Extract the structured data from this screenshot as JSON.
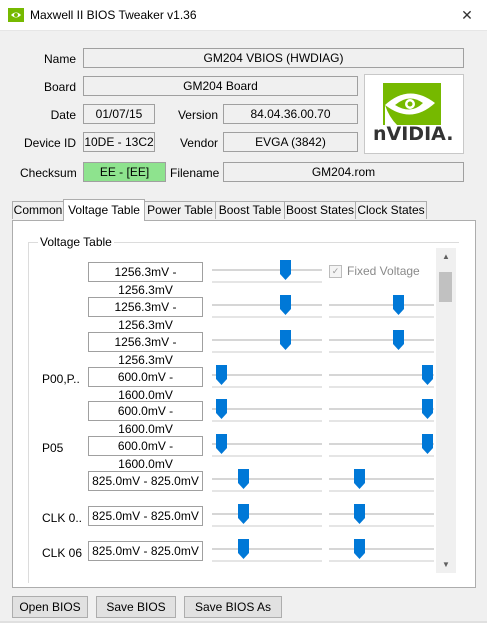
{
  "window": {
    "title": "Maxwell II BIOS Tweaker v1.36",
    "close_glyph": "✕"
  },
  "info": {
    "name_label": "Name",
    "name": "GM204 VBIOS (HWDIAG)",
    "board_label": "Board",
    "board": "GM204 Board",
    "date_label": "Date",
    "date": "01/07/15",
    "version_label": "Version",
    "version": "84.04.36.00.70",
    "device_label": "Device ID",
    "device_id": "10DE - 13C2",
    "vendor_label": "Vendor",
    "vendor": "EVGA (3842)",
    "checksum_label": "Checksum",
    "checksum": "EE - [EE]",
    "filename_label": "Filename",
    "filename": "GM204.rom"
  },
  "logo": {
    "text": "nVIDIA.",
    "icon": "nvidia-eye-icon",
    "color": "#76b900"
  },
  "tabs": [
    "Common",
    "Voltage Table",
    "Power Table",
    "Boost Table",
    "Boost States",
    "Clock States"
  ],
  "active_tab": "Voltage Table",
  "voltage_table": {
    "title": "Voltage Table",
    "fixed_voltage_label": "Fixed Voltage",
    "fixed_voltage_checked": true,
    "rows": [
      {
        "label": "",
        "value": "1256.3mV - 1256.3mV"
      },
      {
        "label": "",
        "value": "1256.3mV - 1256.3mV"
      },
      {
        "label": "",
        "value": "1256.3mV - 1256.3mV"
      },
      {
        "label": "P00,P..",
        "value": "600.0mV - 1600.0mV"
      },
      {
        "label": "",
        "value": "600.0mV - 1600.0mV"
      },
      {
        "label": "P05",
        "value": "600.0mV - 1600.0mV"
      },
      {
        "label": "",
        "value": "825.0mV - 825.0mV"
      },
      {
        "label": "CLK 0..",
        "value": "825.0mV - 825.0mV"
      },
      {
        "label": "CLK 06",
        "value": "825.0mV - 825.0mV"
      }
    ]
  },
  "buttons": {
    "open": "Open BIOS",
    "save": "Save BIOS",
    "save_as": "Save BIOS As"
  },
  "colors": {
    "accent": "#0078d7",
    "checksum_ok": "#8ee38e"
  }
}
